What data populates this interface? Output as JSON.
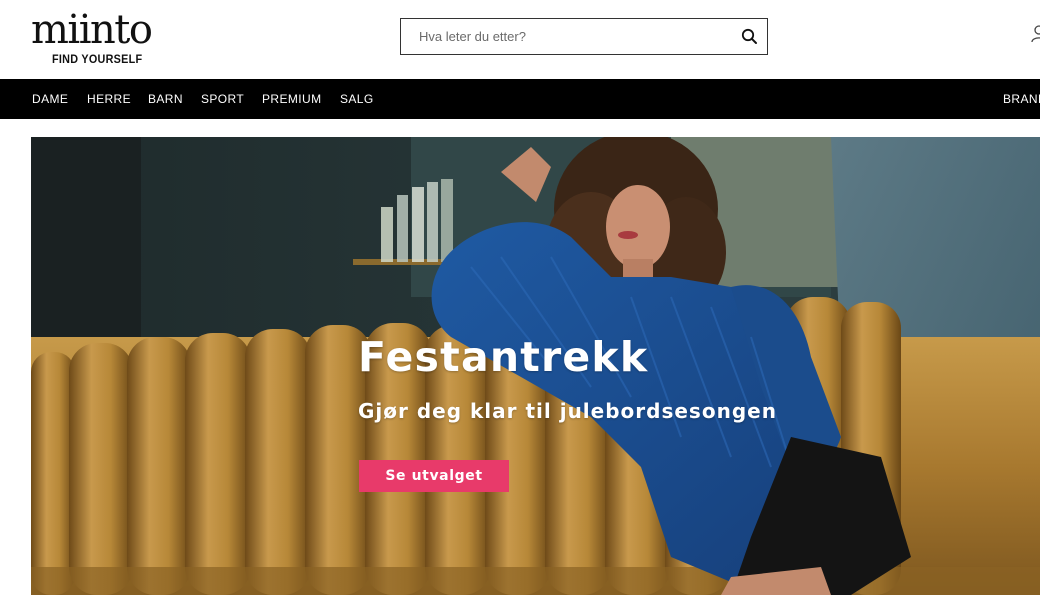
{
  "header": {
    "logo_text": "miinto",
    "logo_tagline": "FIND YOURSELF",
    "search": {
      "placeholder": "Hva leter du etter?",
      "icon": "search-icon"
    },
    "account_icon": "user-icon"
  },
  "nav": {
    "items": [
      {
        "label": "DAME"
      },
      {
        "label": "HERRE"
      },
      {
        "label": "BARN"
      },
      {
        "label": "SPORT"
      },
      {
        "label": "PREMIUM"
      },
      {
        "label": "SALG"
      }
    ],
    "right_item": {
      "label": "BRAND"
    }
  },
  "hero": {
    "title": "Festantrekk",
    "subtitle": "Gjør deg klar til julebordsesongen",
    "cta_label": "Se utvalget",
    "colors": {
      "cta": "#e83a6a",
      "sofa": "#b88a3c",
      "blouse": "#1d4f93",
      "wall": "#2c3b3d"
    }
  },
  "colors": {
    "nav_background": "#000000",
    "header_background": "#ffffff"
  }
}
